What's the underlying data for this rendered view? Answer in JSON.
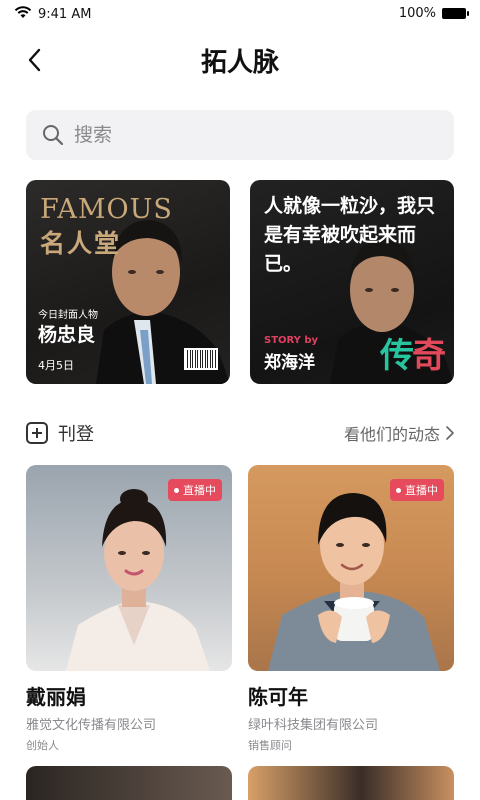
{
  "status": {
    "time": "9:41 AM",
    "battery": "100%"
  },
  "nav": {
    "title": "拓人脉"
  },
  "search": {
    "placeholder": "搜索"
  },
  "featured": [
    {
      "headline": "FAMOUS",
      "subtitle": "名人堂",
      "tag": "今日封面人物",
      "name": "杨忠良",
      "date": "4月5日"
    },
    {
      "quote": "人就像一粒沙，我只是有幸被吹起来而已。",
      "story_by": "STORY by",
      "name": "郑海洋",
      "legend_a": "传",
      "legend_b": "奇"
    }
  ],
  "section": {
    "publish_label": "刊登",
    "feed_link": "看他们的动态"
  },
  "people": [
    {
      "live": "直播中",
      "name": "戴丽娟",
      "company": "雅觉文化传播有限公司",
      "role": "创始人"
    },
    {
      "live": "直播中",
      "name": "陈可年",
      "company": "绿叶科技集团有限公司",
      "role": "销售顾问"
    }
  ]
}
